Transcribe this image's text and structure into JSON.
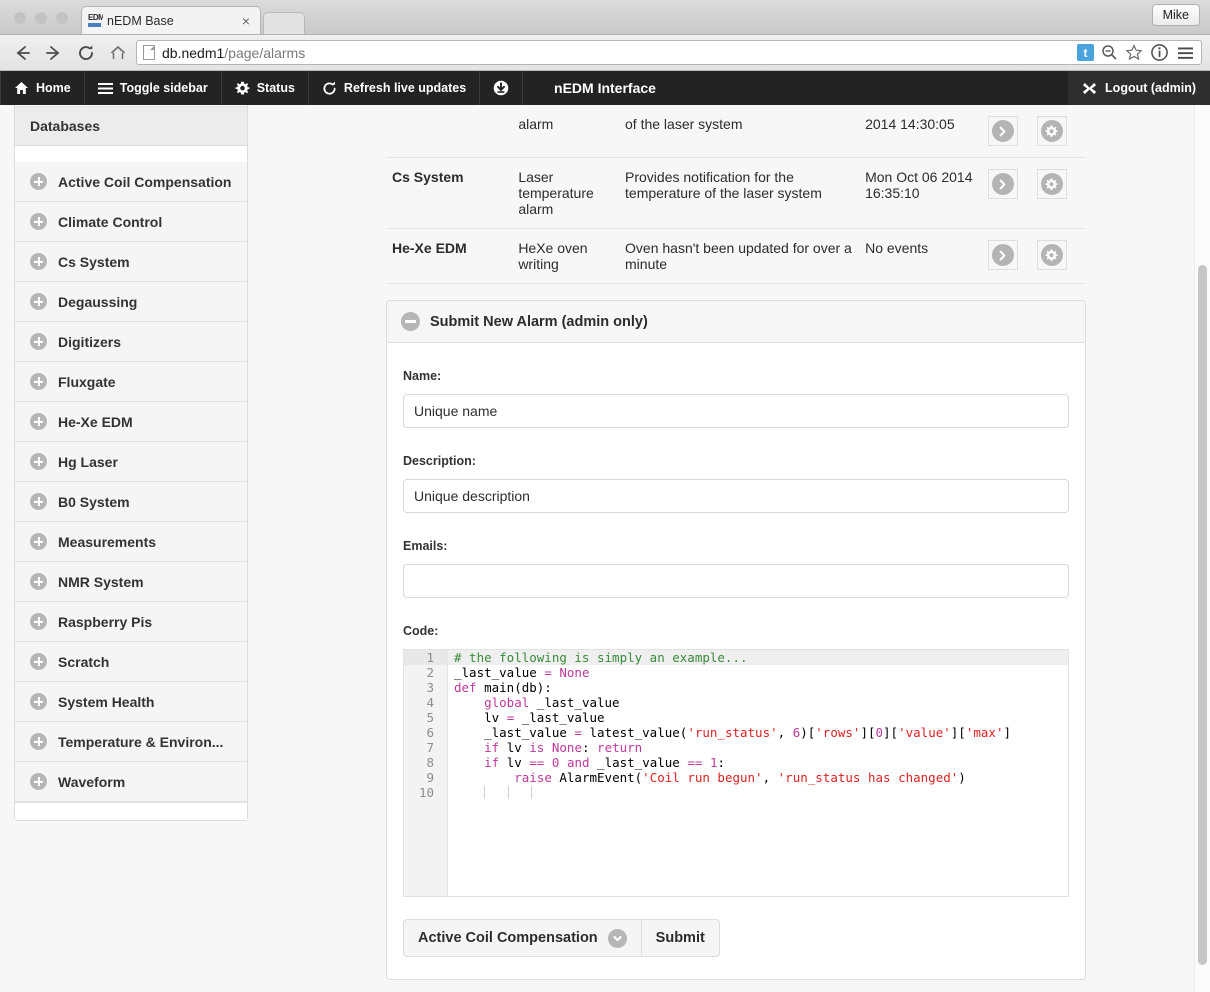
{
  "browser": {
    "tab": {
      "title": "nEDM Base",
      "favicon_text": "EDM",
      "close_label": "×"
    },
    "profile_label": "Mike",
    "url": {
      "host": "db.nedm1",
      "path": "/page/alarms"
    },
    "nav_icons": {
      "back": "back-arrow-icon",
      "forward": "forward-arrow-icon",
      "reload": "reload-icon",
      "home": "home-icon"
    },
    "url_icons": {
      "badge": "t",
      "zoom_out": "zoom-out-icon",
      "bookmark": "star-icon",
      "info": "info-circle-icon",
      "menu": "hamburger-menu-icon"
    }
  },
  "appnav": {
    "title": "nEDM Interface",
    "items": [
      {
        "label": "Home",
        "icon": "home-icon"
      },
      {
        "label": "Toggle sidebar",
        "icon": "hamburger-icon"
      },
      {
        "label": "Status",
        "icon": "gear-icon"
      },
      {
        "label": "Refresh live updates",
        "icon": "refresh-icon"
      },
      {
        "label": "",
        "icon": "download-icon"
      }
    ],
    "logout_label": "Logout (admin)",
    "logout_icon": "close-x-icon"
  },
  "sidebar": {
    "header": "Databases",
    "items": [
      {
        "label": "Active Coil Compensation"
      },
      {
        "label": "Climate Control"
      },
      {
        "label": "Cs System"
      },
      {
        "label": "Degaussing"
      },
      {
        "label": "Digitizers"
      },
      {
        "label": "Fluxgate"
      },
      {
        "label": "He-Xe EDM"
      },
      {
        "label": "Hg Laser"
      },
      {
        "label": "B0 System"
      },
      {
        "label": "Measurements"
      },
      {
        "label": "NMR System"
      },
      {
        "label": "Raspberry Pis"
      },
      {
        "label": "Scratch"
      },
      {
        "label": "System Health"
      },
      {
        "label": "Temperature & Environ..."
      },
      {
        "label": "Waveform"
      }
    ]
  },
  "alarms": {
    "rows": [
      {
        "system": "",
        "short": "alarm",
        "description": "of the laser system",
        "time": "2014 14:30:05"
      },
      {
        "system": "Cs System",
        "short": "Laser temperature alarm",
        "description": "Provides notification for the temperature of the laser system",
        "time": "Mon Oct 06 2014 16:35:10"
      },
      {
        "system": "He-Xe EDM",
        "short": "HeXe oven writing",
        "description": "Oven hasn't been updated for over a minute",
        "time": "No events"
      }
    ],
    "row_actions": {
      "go": "chevron-right-icon",
      "settings": "gear-icon"
    }
  },
  "form": {
    "panel_title": "Submit New Alarm (admin only)",
    "collapse_icon": "minus-circle-icon",
    "name_label": "Name:",
    "name_value": "Unique name",
    "description_label": "Description:",
    "description_value": "Unique description",
    "emails_label": "Emails:",
    "emails_value": "",
    "code_label": "Code:",
    "database_select": "Active Coil Compensation",
    "select_icon": "chevron-down-circle-icon",
    "submit_label": "Submit"
  },
  "code_editor": {
    "line_numbers": [
      "1",
      "2",
      "3",
      "4",
      "5",
      "6",
      "7",
      "8",
      "9",
      "10"
    ],
    "fold_lines": [
      3,
      8
    ],
    "active_line": 1,
    "lines": [
      "# the following is simply an example...",
      "_last_value = None",
      "def main(db):",
      "    global _last_value",
      "    lv = _last_value",
      "    _last_value = latest_value('run_status', 6)['rows'][0]['value']['max']",
      "    if lv is None: return",
      "    if lv == 0 and _last_value == 1:",
      "        raise AlarmEvent('Coil run begun', 'run_status has changed')",
      ""
    ]
  },
  "colors": {
    "navbar_bg": "#232323",
    "comment": "#3a8b3a",
    "keyword": "#c0399b",
    "string": "#dd2222",
    "accent_badge": "#4aa3dd"
  }
}
